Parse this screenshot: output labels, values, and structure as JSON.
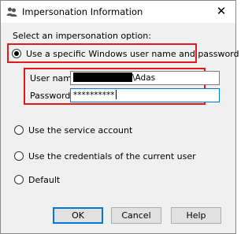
{
  "window": {
    "title": "Impersonation Information",
    "close_label": "✕"
  },
  "prompt": "Select an impersonation option:",
  "options": [
    {
      "label": "Use a specific Windows user name and password",
      "selected": true
    },
    {
      "label": "Use the service account",
      "selected": false
    },
    {
      "label": "Use the credentials of the current user",
      "selected": false
    },
    {
      "label": "Default",
      "selected": false
    }
  ],
  "fields": {
    "username_label": "User name:",
    "username_suffix": "\\Adas",
    "password_label": "Password:",
    "password_value": "**********"
  },
  "buttons": {
    "ok": "OK",
    "cancel": "Cancel",
    "help": "Help"
  },
  "colors": {
    "highlight": "#e31a1c",
    "focus": "#0078d7",
    "dialog_bg": "#f0f0f0"
  }
}
